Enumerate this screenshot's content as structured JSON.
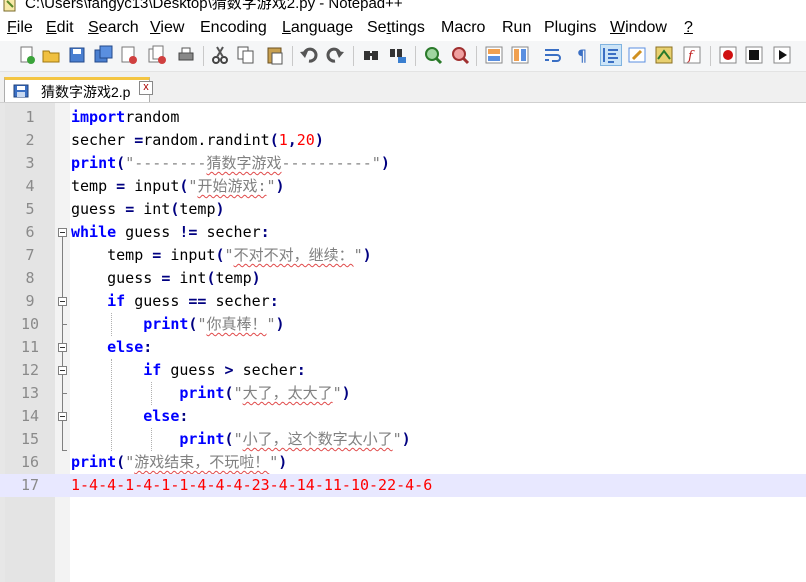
{
  "window": {
    "title": "C:\\Users\\fangyc13\\Desktop\\猜数字游戏2.py - Notepad++"
  },
  "menu": [
    {
      "pre": "",
      "u": "F",
      "post": "ile"
    },
    {
      "pre": "",
      "u": "E",
      "post": "dit"
    },
    {
      "pre": "",
      "u": "S",
      "post": "earch"
    },
    {
      "pre": "",
      "u": "V",
      "post": "iew"
    },
    {
      "pre": "",
      "u": "",
      "post": "Encoding"
    },
    {
      "pre": "",
      "u": "L",
      "post": "anguage"
    },
    {
      "pre": "Se",
      "u": "t",
      "post": "tings"
    },
    {
      "pre": "",
      "u": "",
      "post": "Macro"
    },
    {
      "pre": "",
      "u": "",
      "post": "Run"
    },
    {
      "pre": "",
      "u": "",
      "post": "Plugins"
    },
    {
      "pre": "",
      "u": "W",
      "post": "indow"
    },
    {
      "pre": "",
      "u": "?",
      "post": ""
    }
  ],
  "toolbar_icons": [
    "new-file-icon",
    "open-file-icon",
    "save-icon",
    "save-all-icon",
    "close-icon",
    "close-all-icon",
    "print-icon",
    "cut-icon",
    "copy-icon",
    "paste-icon",
    "undo-icon",
    "redo-icon",
    "find-icon",
    "replace-icon",
    "zoom-in-icon",
    "zoom-out-icon",
    "sync-vertical-icon",
    "sync-horizontal-icon",
    "word-wrap-icon",
    "show-all-chars-icon",
    "indent-guide-icon",
    "user-defined-lang-icon",
    "doc-map-icon",
    "function-list-icon",
    "record-macro-icon",
    "stop-record-icon",
    "play-macro-icon"
  ],
  "tab": {
    "label": "猜数字游戏2.p",
    "close": "x"
  },
  "colors": {
    "keyword": "#0000ff",
    "number": "#ff0000",
    "string": "#808080",
    "current_line": "#e8e8ff",
    "tab_accent": "#f4c542"
  },
  "lines": [
    {
      "n": "1",
      "tokens": [
        [
          "kw",
          "import"
        ],
        [
          "",
          "random"
        ]
      ]
    },
    {
      "n": "2",
      "tokens": [
        [
          "",
          "secher "
        ],
        [
          "op",
          "="
        ],
        [
          "",
          "random.randint"
        ],
        [
          "op",
          "("
        ],
        [
          "num",
          "1"
        ],
        [
          "op",
          ","
        ],
        [
          "num",
          "20"
        ],
        [
          "op",
          ")"
        ]
      ]
    },
    {
      "n": "3",
      "tokens": [
        [
          "kw",
          "print"
        ],
        [
          "op",
          "("
        ],
        [
          "str",
          "\"--------"
        ],
        [
          "strsq",
          "猜数字游戏"
        ],
        [
          "str",
          "----------\""
        ],
        [
          "op",
          ")"
        ]
      ]
    },
    {
      "n": "4",
      "tokens": [
        [
          "",
          "temp "
        ],
        [
          "op",
          "="
        ],
        [
          "",
          ""
        ],
        [
          "bi",
          " input"
        ],
        [
          "op",
          "("
        ],
        [
          "str",
          "\""
        ],
        [
          "strsq",
          "开始游戏:"
        ],
        [
          "str",
          "\""
        ],
        [
          "op",
          ")"
        ]
      ]
    },
    {
      "n": "5",
      "tokens": [
        [
          "",
          "guess "
        ],
        [
          "op",
          "="
        ],
        [
          "bi",
          " int"
        ],
        [
          "op",
          "("
        ],
        [
          "",
          "temp"
        ],
        [
          "op",
          ")"
        ]
      ]
    },
    {
      "n": "6",
      "tokens": [
        [
          "kw",
          "while"
        ],
        [
          "",
          " guess "
        ],
        [
          "op",
          "!="
        ],
        [
          "",
          " secher"
        ],
        [
          "op",
          ":"
        ]
      ]
    },
    {
      "n": "7",
      "tokens": [
        [
          "",
          "    temp "
        ],
        [
          "op",
          "="
        ],
        [
          "bi",
          " input"
        ],
        [
          "op",
          "("
        ],
        [
          "str",
          "\""
        ],
        [
          "strsq",
          "不对不对，继续："
        ],
        [
          "str",
          "\""
        ],
        [
          "op",
          ")"
        ]
      ]
    },
    {
      "n": "8",
      "tokens": [
        [
          "",
          "    guess "
        ],
        [
          "op",
          "="
        ],
        [
          "bi",
          " int"
        ],
        [
          "op",
          "("
        ],
        [
          "",
          "temp"
        ],
        [
          "op",
          ")"
        ]
      ]
    },
    {
      "n": "9",
      "tokens": [
        [
          "",
          "    "
        ],
        [
          "kw",
          "if"
        ],
        [
          "",
          " guess "
        ],
        [
          "op",
          "=="
        ],
        [
          "",
          " secher"
        ],
        [
          "op",
          ":"
        ]
      ]
    },
    {
      "n": "10",
      "tokens": [
        [
          "",
          "        "
        ],
        [
          "kw",
          "print"
        ],
        [
          "op",
          "("
        ],
        [
          "str",
          "\""
        ],
        [
          "strsq",
          "你真棒！"
        ],
        [
          "str",
          "\""
        ],
        [
          "op",
          ")"
        ]
      ]
    },
    {
      "n": "11",
      "tokens": [
        [
          "",
          "    "
        ],
        [
          "kw",
          "else"
        ],
        [
          "op",
          ":"
        ]
      ]
    },
    {
      "n": "12",
      "tokens": [
        [
          "",
          "        "
        ],
        [
          "kw",
          "if"
        ],
        [
          "",
          " guess "
        ],
        [
          "op",
          ">"
        ],
        [
          "",
          " secher"
        ],
        [
          "op",
          ":"
        ]
      ]
    },
    {
      "n": "13",
      "tokens": [
        [
          "",
          "            "
        ],
        [
          "kw",
          "print"
        ],
        [
          "op",
          "("
        ],
        [
          "str",
          "\""
        ],
        [
          "strsq",
          "大了，太大了"
        ],
        [
          "str",
          "\""
        ],
        [
          "op",
          ")"
        ]
      ]
    },
    {
      "n": "14",
      "tokens": [
        [
          "",
          "        "
        ],
        [
          "kw",
          "else"
        ],
        [
          "op",
          ":"
        ]
      ]
    },
    {
      "n": "15",
      "tokens": [
        [
          "",
          "            "
        ],
        [
          "kw",
          "print"
        ],
        [
          "op",
          "("
        ],
        [
          "str",
          "\""
        ],
        [
          "strsq",
          "小了，这个数字太小了"
        ],
        [
          "str",
          "\""
        ],
        [
          "op",
          ")"
        ]
      ]
    },
    {
      "n": "16",
      "tokens": [
        [
          "kw",
          "print"
        ],
        [
          "op",
          "("
        ],
        [
          "str",
          "\""
        ],
        [
          "strsq",
          "游戏结束，不玩啦！"
        ],
        [
          "str",
          "\""
        ],
        [
          "op",
          ")"
        ]
      ]
    },
    {
      "n": "17",
      "tokens": [
        [
          "out",
          "1-4-4-1-4-1-1-4-4-4-23-4-14-11-10-22-4-6"
        ]
      ]
    }
  ],
  "current_line": 17
}
